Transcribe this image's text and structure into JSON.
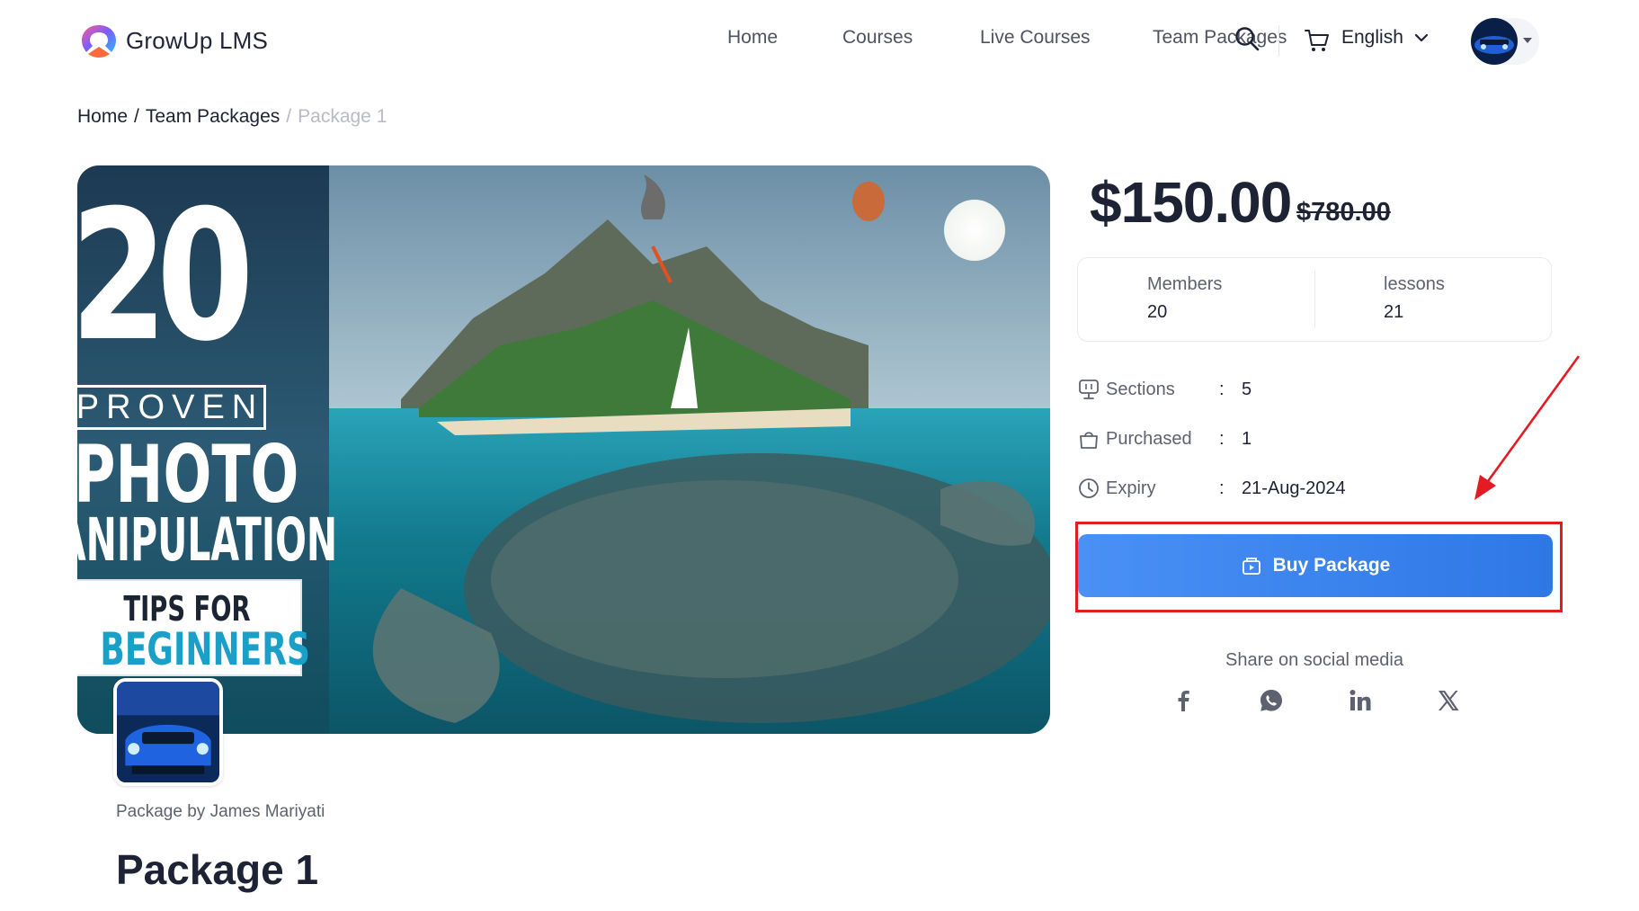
{
  "brand": {
    "name": "GrowUp LMS"
  },
  "nav": {
    "items": [
      {
        "label": "Home"
      },
      {
        "label": "Courses"
      },
      {
        "label": "Live Courses"
      },
      {
        "label": "Team Packages"
      }
    ],
    "language": "English"
  },
  "breadcrumb": {
    "home": "Home",
    "section": "Team Packages",
    "current": "Package 1"
  },
  "hero": {
    "line1": "20",
    "line2": "PROVEN",
    "line3": "PHOTO",
    "line4": "ANIPULATION",
    "line5": "TIPS FOR",
    "line6": "BEGINNERS"
  },
  "package": {
    "author_line": "Package by James Mariyati",
    "title": "Package 1",
    "price": "$150.00",
    "old_price": "$780.00",
    "stats": [
      {
        "label": "Members",
        "value": "20"
      },
      {
        "label": "lessons",
        "value": "21"
      }
    ],
    "meta": {
      "sections": {
        "label": "Sections",
        "value": "5"
      },
      "purchased": {
        "label": "Purchased",
        "value": "1"
      },
      "expiry": {
        "label": "Expiry",
        "value": "21-Aug-2024"
      }
    },
    "colon": ":",
    "buy_label": "Buy Package"
  },
  "share": {
    "label": "Share on social media",
    "icons": [
      "facebook-icon",
      "whatsapp-icon",
      "linkedin-icon",
      "x-icon"
    ]
  },
  "colors": {
    "accent": "#2e78e6",
    "highlight": "#e31b23",
    "text": "#1e2235"
  }
}
